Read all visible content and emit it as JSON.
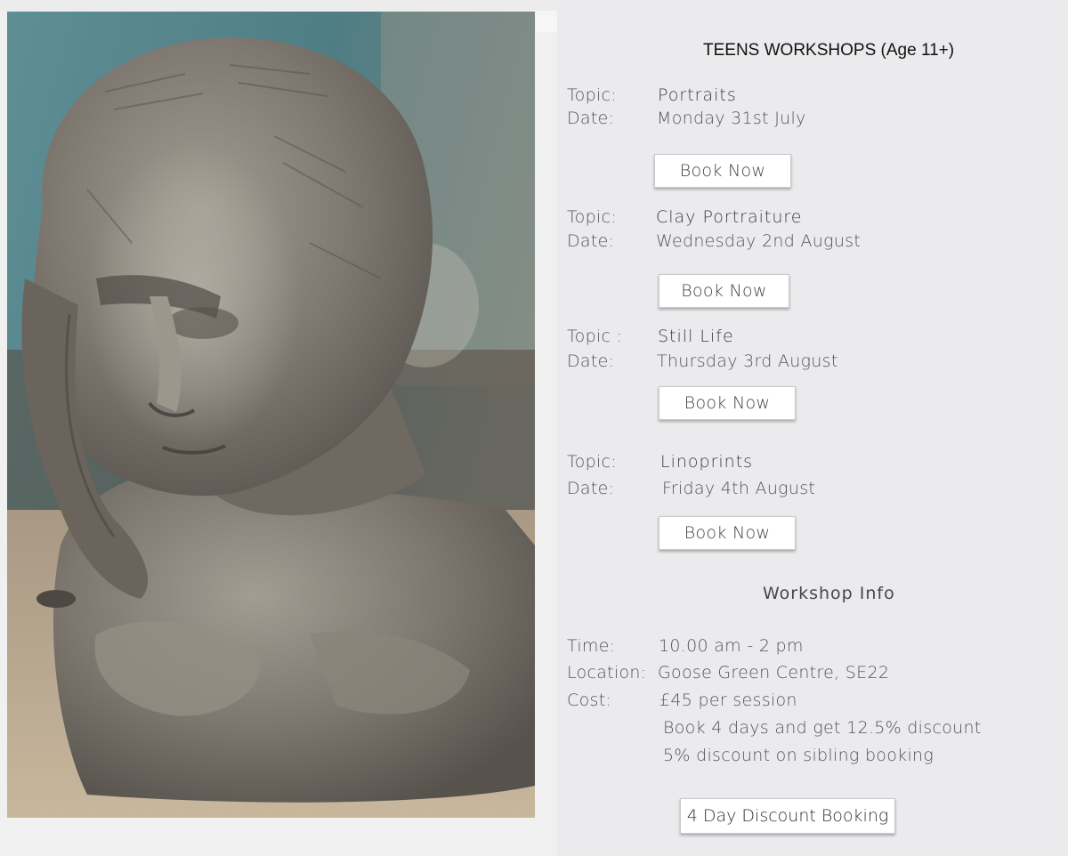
{
  "heading": "TEENS WORKSHOPS (Age 11+)",
  "workshops": [
    {
      "topic_label": "Topic:",
      "topic": "Portraits",
      "date_label": " Date:",
      "date": "Monday 31st July",
      "button": "Book Now"
    },
    {
      "topic_label": "Topic:",
      "topic": "Clay Portraiture",
      "date_label": "Date:",
      "date": "Wednesday 2nd August",
      "button": "Book Now"
    },
    {
      "topic_label": "Topic :",
      "topic": "Still Life",
      "date_label": "Date:",
      "date": "Thursday 3rd  August",
      "button": "Book Now"
    },
    {
      "topic_label": "Topic:",
      "topic": "Linoprints",
      "date_label": "Date:",
      "date": "Friday 4th  August",
      "button": "Book Now"
    }
  ],
  "info": {
    "heading": "Workshop Info",
    "time_label": "Time:",
    "time": "10.00 am - 2 pm",
    "location_label": "Location:",
    "location": "Goose Green Centre, SE22",
    "cost_label": "Cost:",
    "cost": "£45 per session",
    "discount_line1": "Book 4 days and get 12.5% discount",
    "discount_line2": "5% discount on sibling booking"
  },
  "discount_button": "4 Day Discount Booking",
  "colors": {
    "panel_bg": "#ebebed",
    "text": "#54545c",
    "button_bg": "#ffffff"
  }
}
